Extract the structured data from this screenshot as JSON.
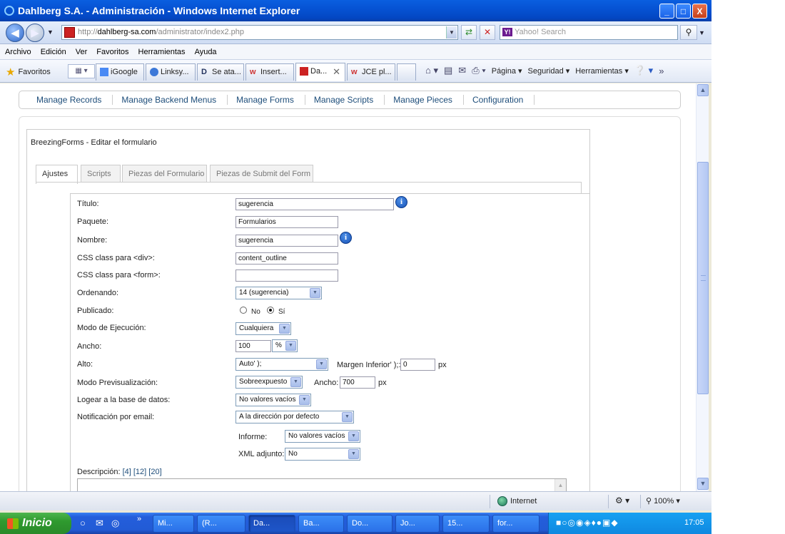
{
  "window": {
    "title": "Dahlberg S.A. - Administración - Windows Internet Explorer",
    "minimize": "_",
    "maximize": "□",
    "close": "X"
  },
  "address": {
    "url_prefix": "http://",
    "url_domain": "dahlberg-sa.com",
    "url_path": "/administrator/index2.php",
    "search_placeholder": "Yahoo! Search",
    "yahoo_badge": "Y!"
  },
  "menu": [
    "Archivo",
    "Edición",
    "Ver",
    "Favoritos",
    "Herramientas",
    "Ayuda"
  ],
  "favorites": {
    "label": "Favoritos",
    "tabs": [
      {
        "label": "iGoogle"
      },
      {
        "label": "Linksy..."
      },
      {
        "label": "Se ata..."
      },
      {
        "label": "Insert..."
      },
      {
        "label": "Da..."
      },
      {
        "label": "JCE pl..."
      }
    ]
  },
  "toolbar_right": {
    "pagina": "Página",
    "seguridad": "Seguridad",
    "herramientas": "Herramientas"
  },
  "submenu": [
    "Manage Records",
    "Manage Backend Menus",
    "Manage Forms",
    "Manage Scripts",
    "Manage Pieces",
    "Configuration"
  ],
  "editor": {
    "title": "BreezingForms - Editar el formulario",
    "tabs": [
      "Ajustes",
      "Scripts",
      "Piezas del Formulario",
      "Piezas de Submit del Form"
    ]
  },
  "form": {
    "titulo": {
      "label": "Título:",
      "value": "sugerencia"
    },
    "paquete": {
      "label": "Paquete:",
      "value": "Formularios"
    },
    "nombre": {
      "label": "Nombre:",
      "value": "sugerencia"
    },
    "css_div": {
      "label": "CSS class para <div>:",
      "value": "content_outline"
    },
    "css_form": {
      "label": "CSS class para <form>:",
      "value": ""
    },
    "ordenando": {
      "label": "Ordenando:",
      "value": "14 (sugerencia)"
    },
    "publicado": {
      "label": "Publicado:",
      "opt_no": "No",
      "opt_si": "Sí",
      "selected": "Sí"
    },
    "modo_ejecucion": {
      "label": "Modo de Ejecución:",
      "value": "Cualquiera"
    },
    "ancho": {
      "label": "Ancho:",
      "value": "100",
      "unit": "%"
    },
    "alto": {
      "label": "Alto:",
      "value": "Auto' );",
      "margen_label": "Margen Inferior' );:",
      "margen_value": "0",
      "px": "px"
    },
    "previsualizacion": {
      "label": "Modo Previsualización:",
      "value": "Sobreexpuesto",
      "ancho_label": "Ancho:",
      "ancho_value": "700",
      "px": "px"
    },
    "logear": {
      "label": "Logear a la base de datos:",
      "value": "No valores vacíos"
    },
    "notificacion": {
      "label": "Notificación por email:",
      "value": "A la dirección por defecto"
    },
    "informe": {
      "label": "Informe:",
      "value": "No valores vacíos"
    },
    "xml": {
      "label": "XML adjunto:",
      "value": "No"
    },
    "descripcion": {
      "label": "Descripción:",
      "links": "[4] [12] [20]"
    }
  },
  "status": {
    "zone": "Internet",
    "zoom": "100%"
  },
  "taskbar": {
    "start": "Inicio",
    "tasks": [
      "Mi...",
      "(R...",
      "Da...",
      "Ba...",
      "Do...",
      "Jo...",
      "15...",
      "for..."
    ],
    "clock": "17:05"
  },
  "colors": {
    "link": "#1d4d7a",
    "titlebar": "#0653d4",
    "taskbar": "#245edb",
    "start": "#2f9a2f"
  }
}
